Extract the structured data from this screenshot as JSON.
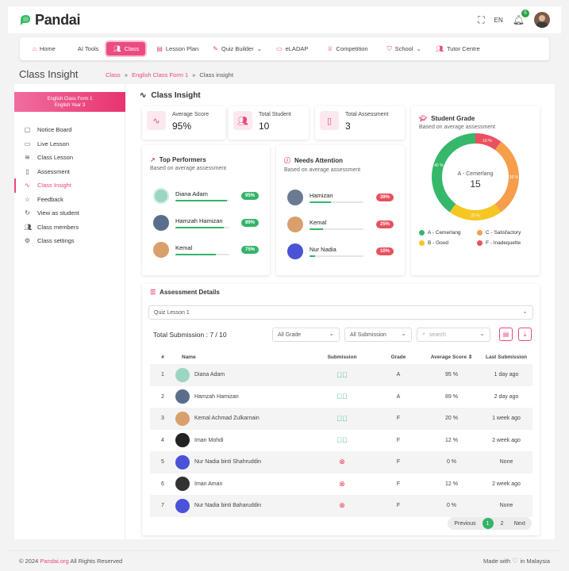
{
  "header": {
    "brand": "Pandai",
    "lang": "EN",
    "notif_count": "5"
  },
  "nav": {
    "items": [
      {
        "label": "Home",
        "icon": "home-icon"
      },
      {
        "label": "AI Tools",
        "icon": ""
      },
      {
        "label": "Class",
        "icon": "users-icon"
      },
      {
        "label": "Lesson Plan",
        "icon": "calendar-icon"
      },
      {
        "label": "Quiz Builder",
        "icon": "puzzle-icon"
      },
      {
        "label": "eLADAP",
        "icon": "monitor-icon"
      },
      {
        "label": "Competition",
        "icon": "trophy-icon"
      },
      {
        "label": "School",
        "icon": "shield-icon"
      },
      {
        "label": "Tutor Centre",
        "icon": "people-icon"
      }
    ],
    "active": "Class"
  },
  "page": {
    "title": "Class Insight",
    "breadcrumb": [
      "Class",
      "English Class Form 1",
      "Class insight"
    ]
  },
  "sidebar": {
    "course_title": "English Class Form 1",
    "course_sub": "English Year 3",
    "items": [
      {
        "label": "Notice Board",
        "icon": "message-icon"
      },
      {
        "label": "Live Lesson",
        "icon": "video-icon"
      },
      {
        "label": "Class Lesson",
        "icon": "layers-icon"
      },
      {
        "label": "Assessment",
        "icon": "clipboard-icon"
      },
      {
        "label": "Class Insight",
        "icon": "activity-icon"
      },
      {
        "label": "Feedback",
        "icon": "star-icon"
      },
      {
        "label": "View as student",
        "icon": "refresh-icon"
      },
      {
        "label": "Class members",
        "icon": "users-icon"
      },
      {
        "label": "Class settings",
        "icon": "gear-icon"
      }
    ]
  },
  "insight": {
    "section_title": "Class Insight",
    "stats": [
      {
        "label": "Average Score",
        "value": "95%"
      },
      {
        "label": "Total Student",
        "value": "10"
      },
      {
        "label": "Total Assessment",
        "value": "3"
      }
    ],
    "top": {
      "title": "Top Performers",
      "sub": "Based on average assessment",
      "rows": [
        {
          "name": "Diana Adam",
          "pct": "95%",
          "level": 0.95
        },
        {
          "name": "Hamzah Hamizan",
          "pct": "89%",
          "level": 0.89
        },
        {
          "name": "Kemal",
          "pct": "75%",
          "level": 0.75
        }
      ]
    },
    "attention": {
      "title": "Needs Attention",
      "sub": "Based on average assessment",
      "rows": [
        {
          "name": "Hamizan",
          "pct": "39%",
          "level": 0.39
        },
        {
          "name": "Kemal",
          "pct": "25%",
          "level": 0.25
        },
        {
          "name": "Nur Nadia",
          "pct": "10%",
          "level": 0.1
        }
      ]
    },
    "grade": {
      "title": "Student Grade",
      "sub": "Based on average assessment",
      "center_label": "A - Cemerlang",
      "center_value": "15"
    }
  },
  "chart_data": {
    "type": "pie",
    "categories": [
      "A - Cemerlang",
      "C - Satisfactory",
      "B - Good",
      "F - Inadequette"
    ],
    "values": [
      40,
      30,
      20,
      10
    ],
    "labels": [
      "40 %",
      "30 %",
      "20 %",
      "10 %"
    ],
    "colors": [
      "#35b86a",
      "#f79e4c",
      "#f6c623",
      "#e9515f"
    ],
    "title": "",
    "legend": "bottom"
  },
  "assessment": {
    "title": "Assessment Details",
    "quiz_select": "Quiz Lesson 1",
    "total_label": "Total Submission : 7 / 10",
    "grade_filter": "All Grade",
    "sub_filter": "All Submission",
    "search_placeholder": "search",
    "columns": [
      "#",
      "Name",
      "Submission",
      "Grade",
      "Average Score",
      "Last Submission"
    ],
    "rows": [
      {
        "n": "1",
        "name": "Diana Adam",
        "sub": true,
        "grade": "A",
        "score": "95 %",
        "last": "1 day ago"
      },
      {
        "n": "2",
        "name": "Hamzah Hamizan",
        "sub": true,
        "grade": "A",
        "score": "89 %",
        "last": "2 day ago"
      },
      {
        "n": "3",
        "name": "Kemal Achmad Zulkarnain",
        "sub": true,
        "grade": "F",
        "score": "20 %",
        "last": "1 week ago"
      },
      {
        "n": "4",
        "name": "Iman Mohdi",
        "sub": true,
        "grade": "F",
        "score": "12 %",
        "last": "2 week ago"
      },
      {
        "n": "5",
        "name": "Nur Nadia binti Shahruddin",
        "sub": false,
        "grade": "F",
        "score": "0 %",
        "last": "None"
      },
      {
        "n": "6",
        "name": "Iman Aman",
        "sub": false,
        "grade": "F",
        "score": "12 %",
        "last": "2 week ago"
      },
      {
        "n": "7",
        "name": "Nur Nadia binti Baharuddin",
        "sub": false,
        "grade": "F",
        "score": "0 %",
        "last": "None"
      }
    ],
    "pager": {
      "prev": "Previous",
      "pages": [
        "1",
        "2"
      ],
      "next": "Next"
    }
  },
  "footer": {
    "copy_prefix": "© 2024",
    "site": "Pandai.org",
    "copy_suffix": "All Rights Reserved",
    "made_prefix": "Made with",
    "made_suffix": "in Malaysia"
  }
}
